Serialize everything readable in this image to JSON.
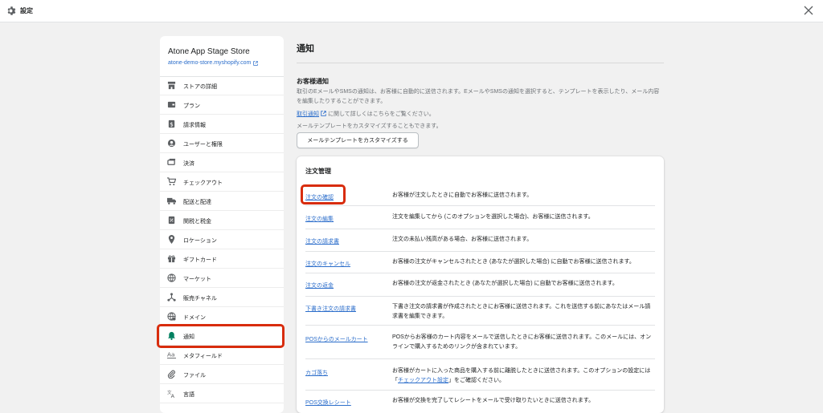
{
  "topbar": {
    "title": "設定"
  },
  "sidebar": {
    "store_name": "Atone App Stage Store",
    "store_url": "atone-demo-store.myshopify.com",
    "items": [
      {
        "label": "ストアの詳細",
        "icon": "store-icon"
      },
      {
        "label": "プラン",
        "icon": "plan-icon"
      },
      {
        "label": "請求情報",
        "icon": "billing-icon"
      },
      {
        "label": "ユーザーと権限",
        "icon": "user-icon"
      },
      {
        "label": "決済",
        "icon": "payment-icon"
      },
      {
        "label": "チェックアウト",
        "icon": "cart-icon"
      },
      {
        "label": "配送と配達",
        "icon": "truck-icon"
      },
      {
        "label": "関税と税金",
        "icon": "tax-icon"
      },
      {
        "label": "ロケーション",
        "icon": "location-icon"
      },
      {
        "label": "ギフトカード",
        "icon": "gift-icon"
      },
      {
        "label": "マーケット",
        "icon": "globe-icon"
      },
      {
        "label": "販売チャネル",
        "icon": "channel-icon"
      },
      {
        "label": "ドメイン",
        "icon": "domain-icon"
      },
      {
        "label": "通知",
        "icon": "bell-icon",
        "active": true
      },
      {
        "label": "メタフィールド",
        "icon": "metafield-icon"
      },
      {
        "label": "ファイル",
        "icon": "attachment-icon"
      },
      {
        "label": "言語",
        "icon": "language-icon"
      }
    ]
  },
  "main": {
    "title": "通知",
    "customer": {
      "heading": "お客様通知",
      "description": "取引のEメールやSMSの通知は、お客様に自動的に送信されます。EメールやSMSの通知を選択すると、テンプレートを表示したり、メール内容を編集したりすることができます。",
      "link_text": "取引通知",
      "link_suffix": "に関して詳しくはこちらをご覧ください。",
      "more_text": "メールテンプレートをカスタマイズすることもできます。",
      "button_label": "メールテンプレートをカスタマイズする"
    },
    "orders": {
      "heading": "注文管理",
      "rows": [
        {
          "name": "注文の確認",
          "desc": "お客様が注文したときに自動でお客様に送信されます。"
        },
        {
          "name": "注文の編集",
          "desc": "注文を編集してから (このオプションを選択した場合)、お客様に送信されます。"
        },
        {
          "name": "注文の請求書",
          "desc": "注文の未払い残高がある場合、お客様に送信されます。"
        },
        {
          "name": "注文のキャンセル",
          "desc": "お客様の注文がキャンセルされたとき (あなたが選択した場合) に自動でお客様に送信されます。"
        },
        {
          "name": "注文の返金",
          "desc": "お客様の注文が返金されたとき (あなたが選択した場合) に自動でお客様に送信されます。"
        },
        {
          "name": "下書き注文の請求書",
          "desc": "下書き注文の請求書が作成されたときにお客様に送信されます。これを送信する前にあなたはメール請求書を編集できます。"
        },
        {
          "name": "POSからのメールカート",
          "desc": "POSからお客様のカート内容をメールで送信したときにお客様に送信されます。このメールには、オンラインで購入するためのリンクが含まれています。"
        },
        {
          "name": "カゴ落ち",
          "desc_pre": "お客様がカートに入った商品を購入する前に離脱したときに送信されます。このオプションの設定には「",
          "desc_link": "チェックアウト設定",
          "desc_post": "」をご確認ください。"
        },
        {
          "name": "POS交換レシート",
          "desc": "お客様が交換を完了してレシートをメールで受け取りたいときに送信されます。"
        }
      ]
    }
  },
  "colors": {
    "link": "#2c6ecb",
    "highlight": "#d82c0d",
    "active_icon": "#008060"
  }
}
